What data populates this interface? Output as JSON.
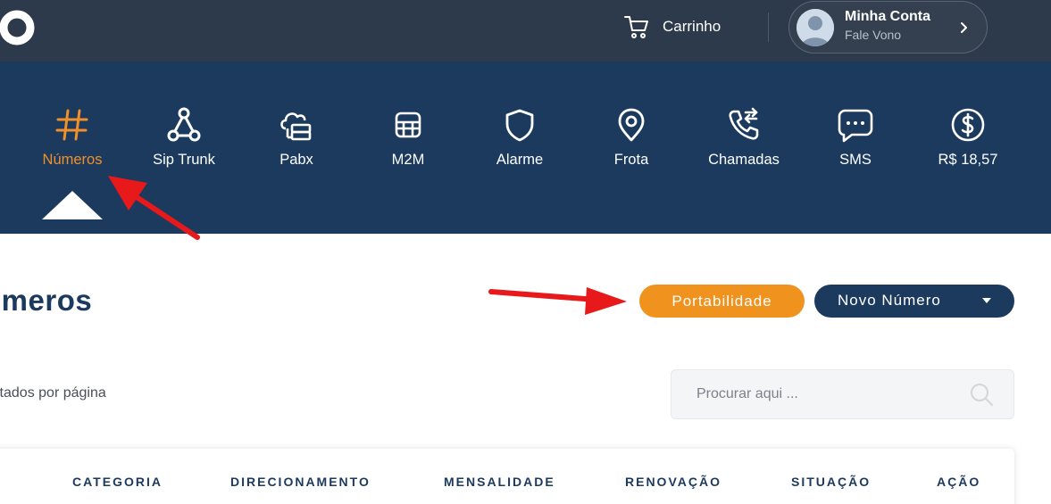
{
  "topbar": {
    "cart_label": "Carrinho",
    "account": {
      "name": "Minha Conta",
      "subtitle": "Fale Vono"
    }
  },
  "services": [
    {
      "label": "Números",
      "icon": "hash-icon",
      "active": true
    },
    {
      "label": "Sip Trunk",
      "icon": "network-nodes-icon",
      "active": false
    },
    {
      "label": "Pabx",
      "icon": "cloud-server-icon",
      "active": false
    },
    {
      "label": "M2M",
      "icon": "sim-chip-icon",
      "active": false
    },
    {
      "label": "Alarme",
      "icon": "shield-icon",
      "active": false
    },
    {
      "label": "Frota",
      "icon": "location-pin-icon",
      "active": false
    },
    {
      "label": "Chamadas",
      "icon": "phone-transfer-icon",
      "active": false
    },
    {
      "label": "SMS",
      "icon": "chat-bubble-icon",
      "active": false
    },
    {
      "label": "R$ 18,57",
      "icon": "dollar-circle-icon",
      "active": false
    }
  ],
  "page": {
    "title": "úmeros",
    "portabilidade_label": "Portabilidade",
    "novo_numero_label": "Novo Número",
    "per_page_label": "ltados por página",
    "search_placeholder": "Procurar aqui ..."
  },
  "table": {
    "columns": [
      "CATEGORIA",
      "DIRECIONAMENTO",
      "MENSALIDADE",
      "RENOVAÇÃO",
      "SITUAÇÃO",
      "AÇÃO"
    ]
  },
  "colors": {
    "topbar": "#2d3a4b",
    "servicebar": "#1b3a5e",
    "accent_orange": "#f0921e",
    "annotation_red": "#e8191a"
  }
}
